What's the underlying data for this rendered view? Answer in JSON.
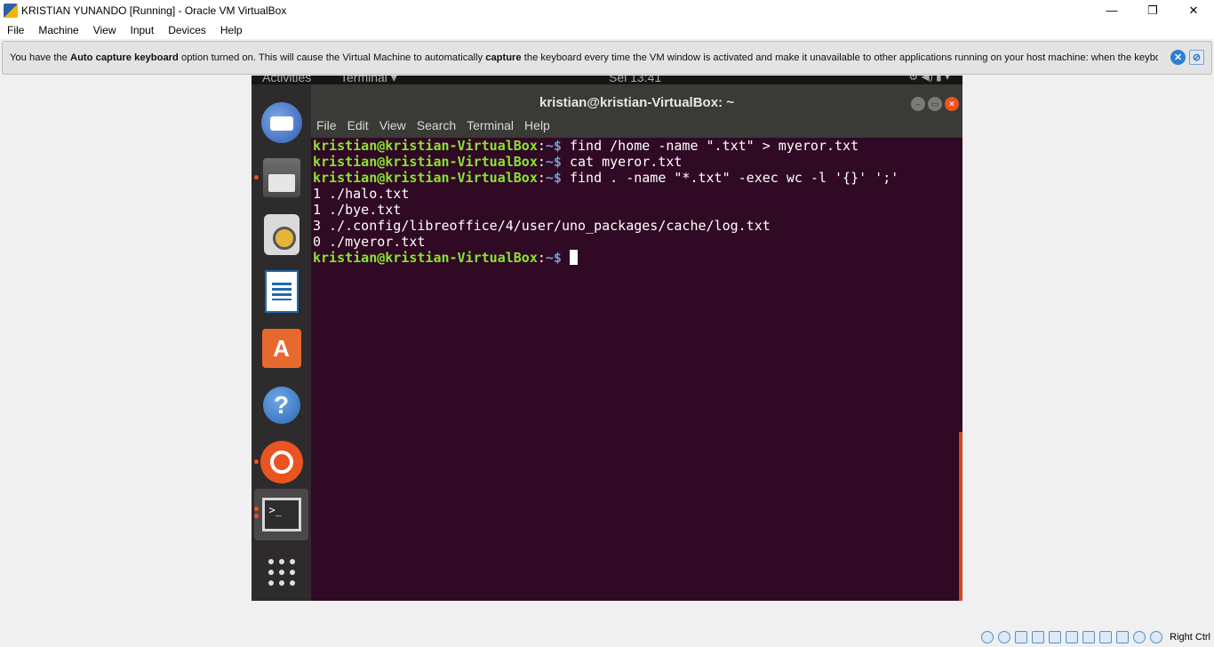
{
  "window": {
    "title": "KRISTIAN YUNANDO [Running] - Oracle VM VirtualBox",
    "minimize": "—",
    "restore": "❐",
    "close": "✕"
  },
  "menubar": [
    "File",
    "Machine",
    "View",
    "Input",
    "Devices",
    "Help"
  ],
  "notification": {
    "t1": "You have the ",
    "b1": "Auto capture keyboard",
    "t2": " option turned on. This will cause the Virtual Machine to automatically ",
    "b2": "capture",
    "t3": " the keyboard every time the VM window is activated and make it unavailable to other applications running on your host machine: when the keyboard is"
  },
  "vm_topbar": {
    "activities": "Activities",
    "app": "Terminal ▾",
    "clock": "Sel 13:41",
    "system": "⚙ ◀) ▮ ▾"
  },
  "dock": {
    "items": [
      "thunderbird-icon",
      "files-icon",
      "rhythmbox-icon",
      "libreoffice-writer-icon",
      "software-center-icon",
      "help-icon",
      "ubuntu-icon",
      "terminal-icon",
      "show-apps-icon"
    ]
  },
  "terminal": {
    "title": "kristian@kristian-VirtualBox: ~",
    "menu": [
      "File",
      "Edit",
      "View",
      "Search",
      "Terminal",
      "Help"
    ],
    "prompt_user": "kristian@kristian-VirtualBox",
    "prompt_path": "~$",
    "lines": [
      {
        "type": "cmd",
        "text": " find /home -name \".txt\" > myeror.txt"
      },
      {
        "type": "cmd",
        "text": " cat myeror.txt"
      },
      {
        "type": "cmd",
        "text": " find . -name \"*.txt\" -exec wc -l '{}' ';'"
      },
      {
        "type": "out",
        "text": "1 ./halo.txt"
      },
      {
        "type": "out",
        "text": "1 ./bye.txt"
      },
      {
        "type": "out",
        "text": "3 ./.config/libreoffice/4/user/uno_packages/cache/log.txt"
      },
      {
        "type": "out",
        "text": "0 ./myeror.txt"
      },
      {
        "type": "prompt",
        "text": " "
      }
    ]
  },
  "statusbar": {
    "host_key": "Right Ctrl"
  }
}
